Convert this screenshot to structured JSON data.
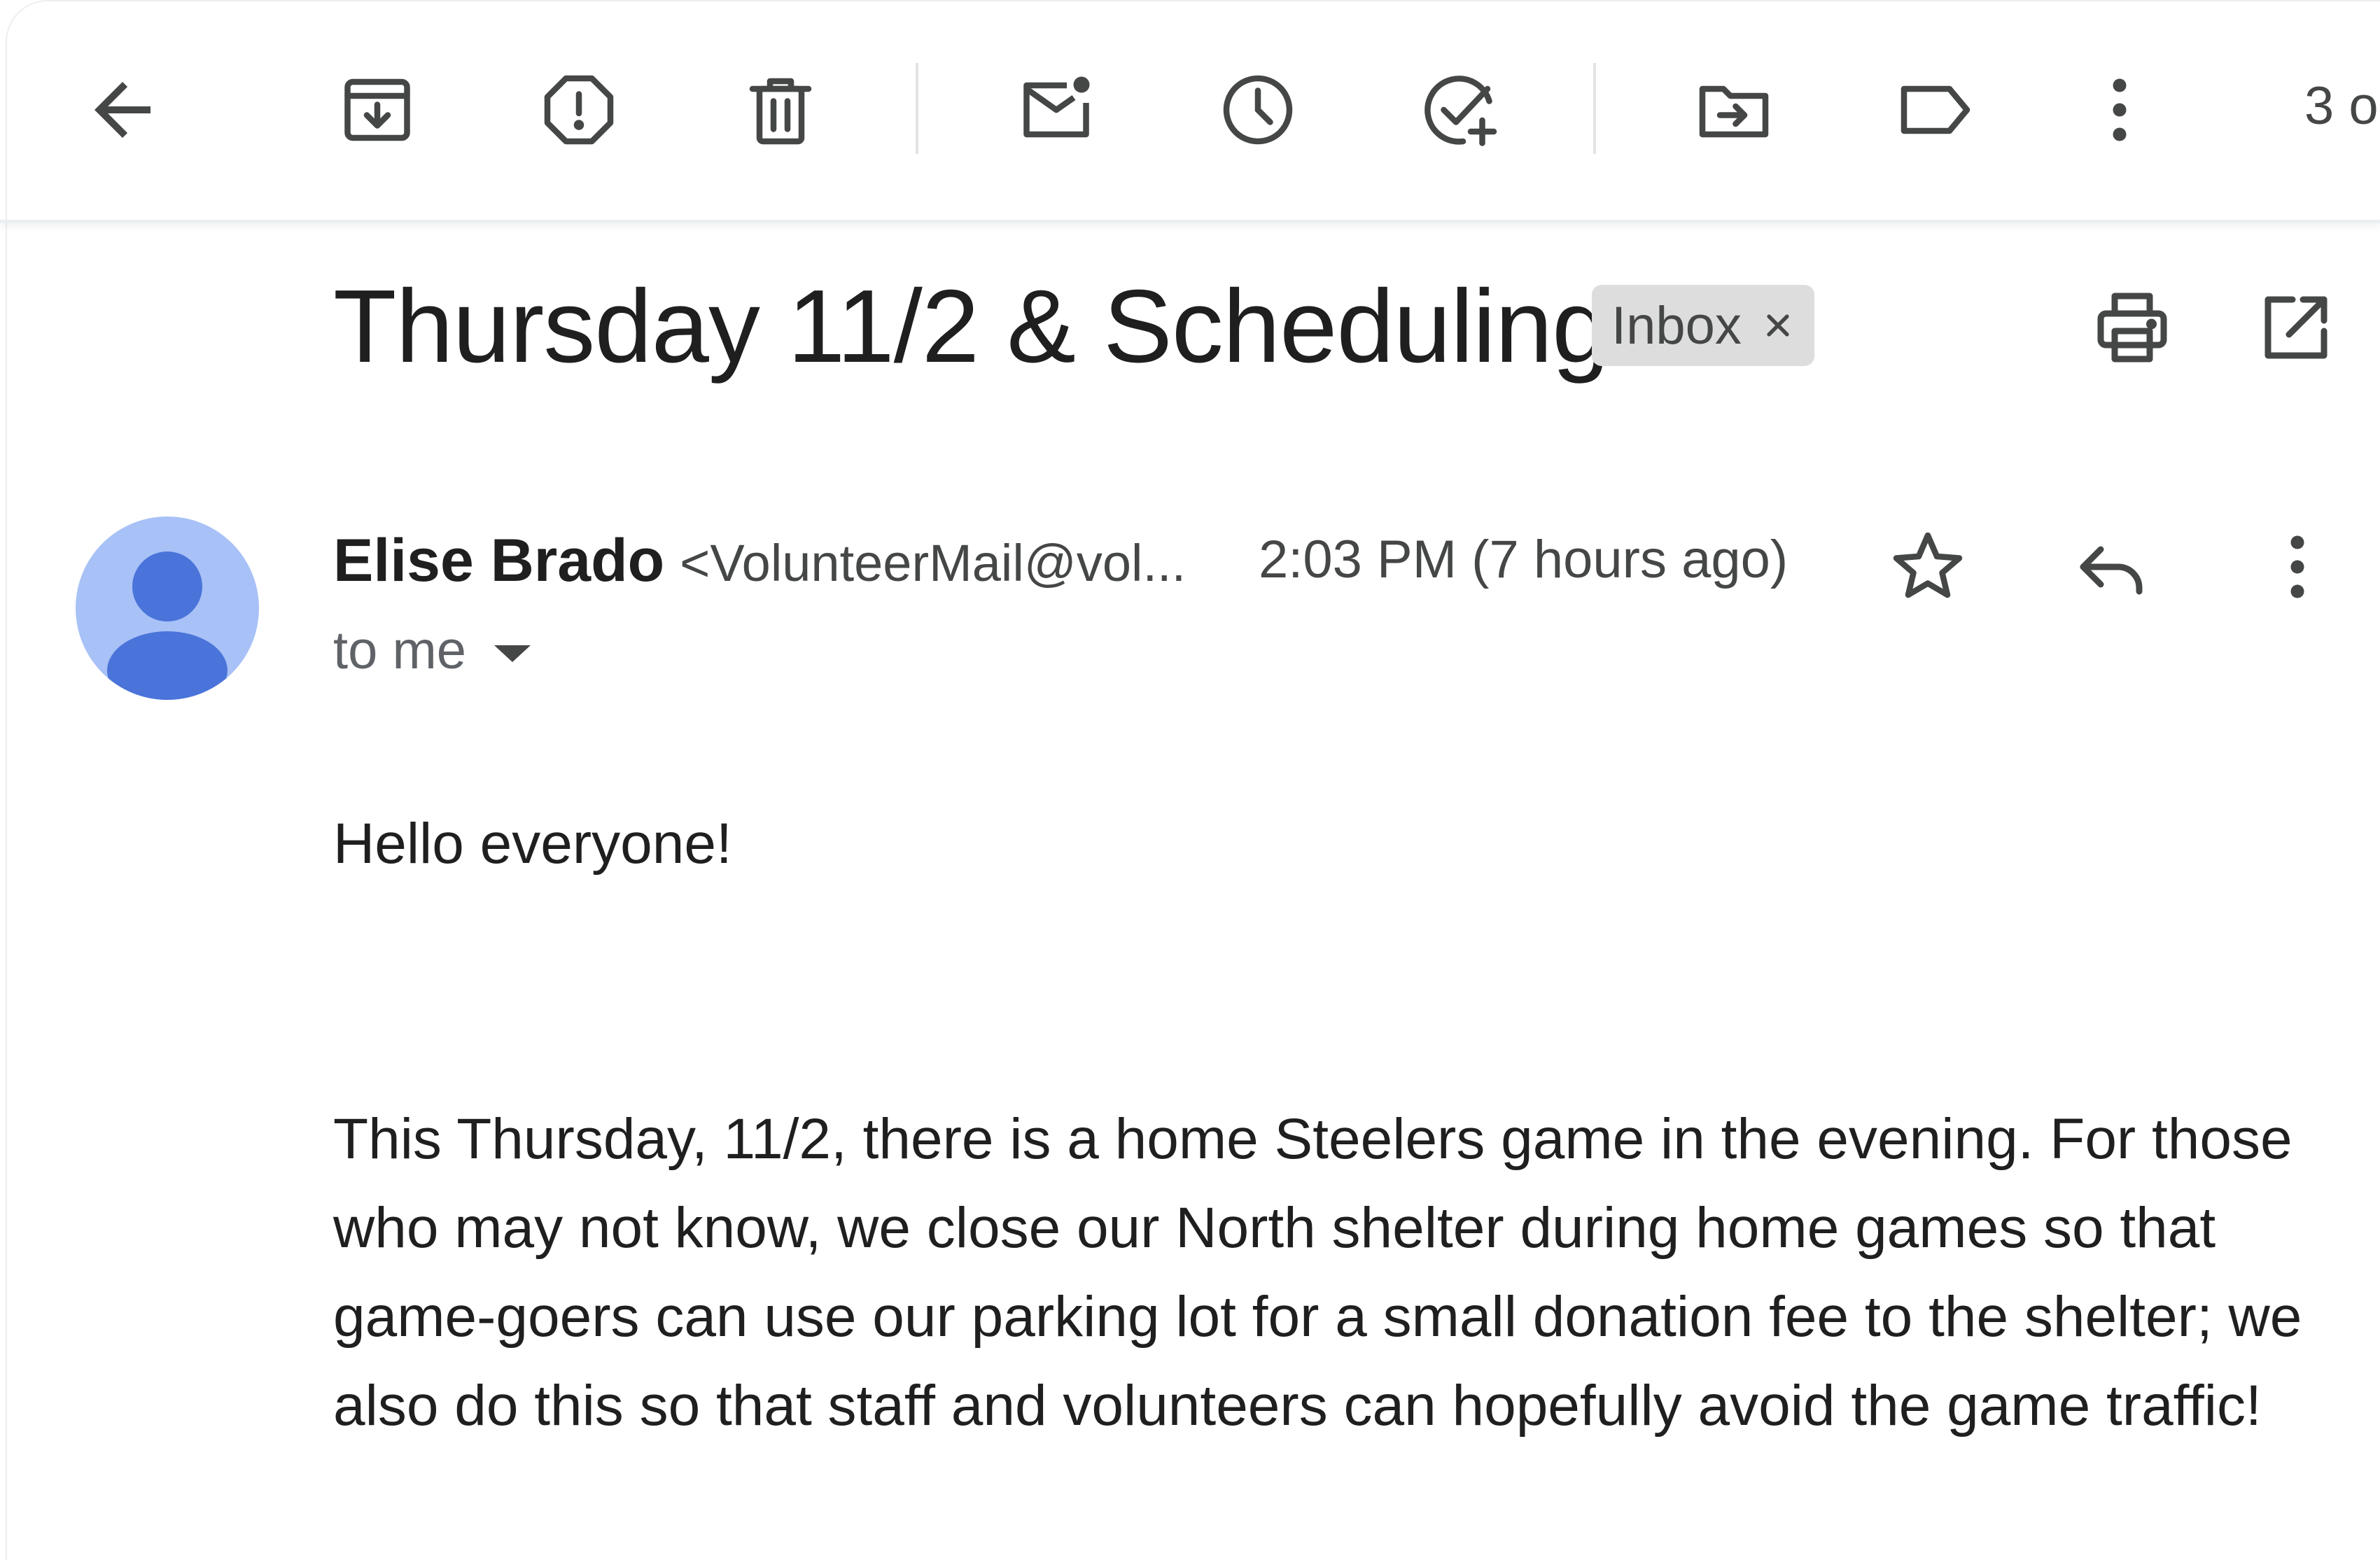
{
  "toolbar": {
    "icons": [
      "back-icon",
      "archive-icon",
      "report-spam-icon",
      "delete-icon",
      "mark-unread-icon",
      "snooze-icon",
      "add-to-tasks-icon",
      "move-to-icon",
      "label-icon",
      "more-vert-icon"
    ],
    "pager_text": "3 o"
  },
  "subject": {
    "title": "Thursday 11/2 & Scheduling",
    "label_chip": "Inbox"
  },
  "message": {
    "sender_name": "Elise Brado",
    "sender_email": "<VolunteerMail@vol...",
    "timestamp": "2:03 PM (7 hours ago)",
    "recipient": "to me",
    "body": {
      "greeting": "Hello everyone!",
      "paragraph": "This Thursday, 11/2, there is a home Steelers game in the evening. For those who may not know, we close our North shelter during home games so that game-goers can use our parking lot for a small donation fee to the shelter; we also do this so that staff and volunteers can hopefully avoid the game traffic!"
    }
  },
  "colors": {
    "icon": "#444746",
    "avatar_bg": "#a8c1f7",
    "avatar_fg": "#4a74d9",
    "chip_bg": "#dddddd"
  }
}
